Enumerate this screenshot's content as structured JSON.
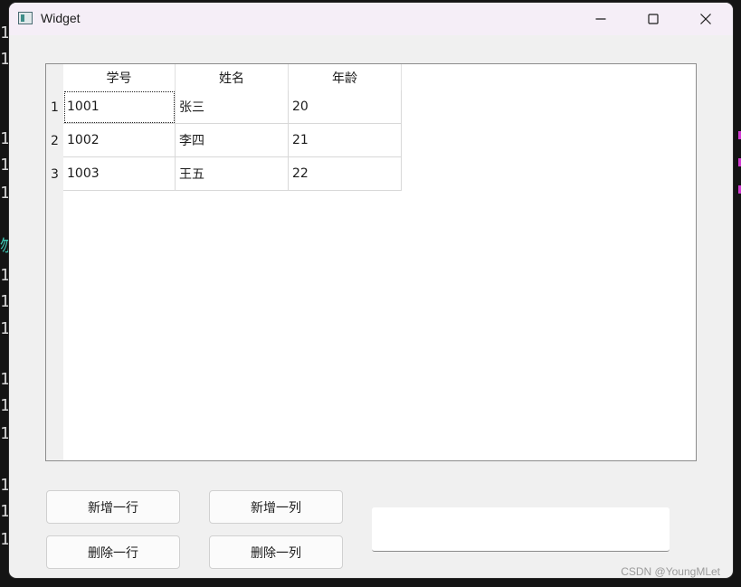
{
  "window": {
    "title": "Widget"
  },
  "table": {
    "headers": [
      "学号",
      "姓名",
      "年龄"
    ],
    "row_numbers": [
      "1",
      "2",
      "3"
    ],
    "rows": [
      [
        "1001",
        "张三",
        "20"
      ],
      [
        "1002",
        "李四",
        "21"
      ],
      [
        "1003",
        "王五",
        "22"
      ]
    ]
  },
  "buttons": {
    "add_row": "新增一行",
    "add_column": "新增一列",
    "delete_row": "删除一行",
    "delete_column": "删除一列"
  },
  "input": {
    "value": "",
    "placeholder": ""
  },
  "watermark": "CSDN @YoungMLet",
  "background": {
    "glyph": "1",
    "glyph_teal": "刎"
  },
  "icons": {
    "app": "window-app-icon",
    "minimize": "minimize-icon",
    "maximize": "maximize-icon",
    "close": "close-icon"
  },
  "colors": {
    "titlebar": "#f5eef7",
    "window_bg": "#f0f0f0",
    "desktop_bg": "#141414"
  }
}
